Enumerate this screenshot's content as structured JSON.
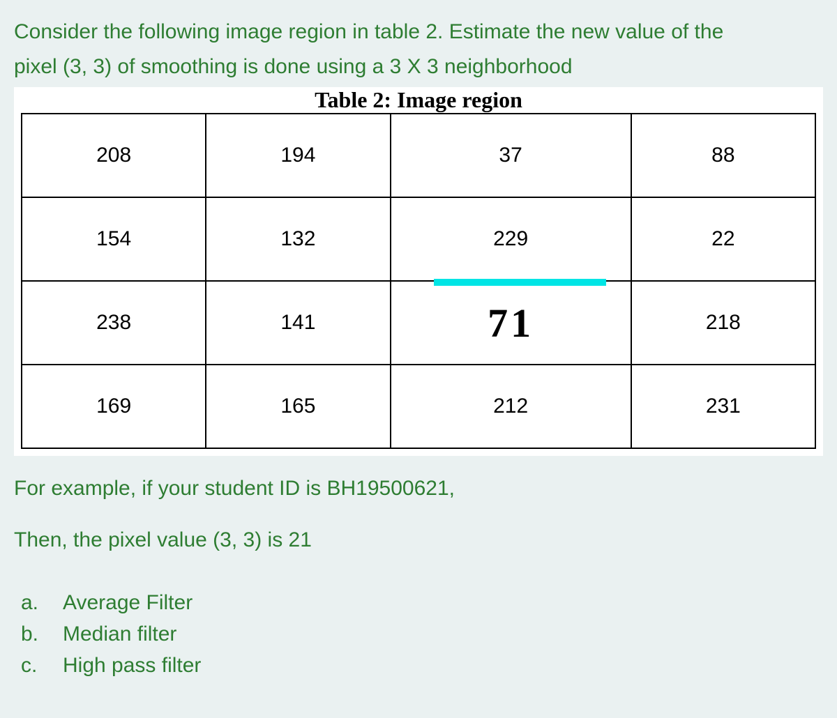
{
  "question": {
    "line1": "Consider the following image region in table 2. Estimate the new value of the",
    "line2": "pixel (3, 3) of smoothing is done using a 3 X 3 neighborhood"
  },
  "table": {
    "title": "Table 2: Image region",
    "rows": [
      [
        "208",
        "194",
        "37",
        "88"
      ],
      [
        "154",
        "132",
        "229",
        "22"
      ],
      [
        "238",
        "141",
        "71",
        "218"
      ],
      [
        "169",
        "165",
        "212",
        "231"
      ]
    ],
    "handwritten_cell": {
      "row": 2,
      "col": 2,
      "value": "71"
    }
  },
  "example": {
    "line1": "For example, if your student ID is BH19500621,",
    "line2": "Then, the pixel value (3, 3) is 21"
  },
  "options": [
    {
      "letter": "a.",
      "label": "Average Filter"
    },
    {
      "letter": "b.",
      "label": "Median filter"
    },
    {
      "letter": "c.",
      "label": "High pass filter"
    }
  ]
}
